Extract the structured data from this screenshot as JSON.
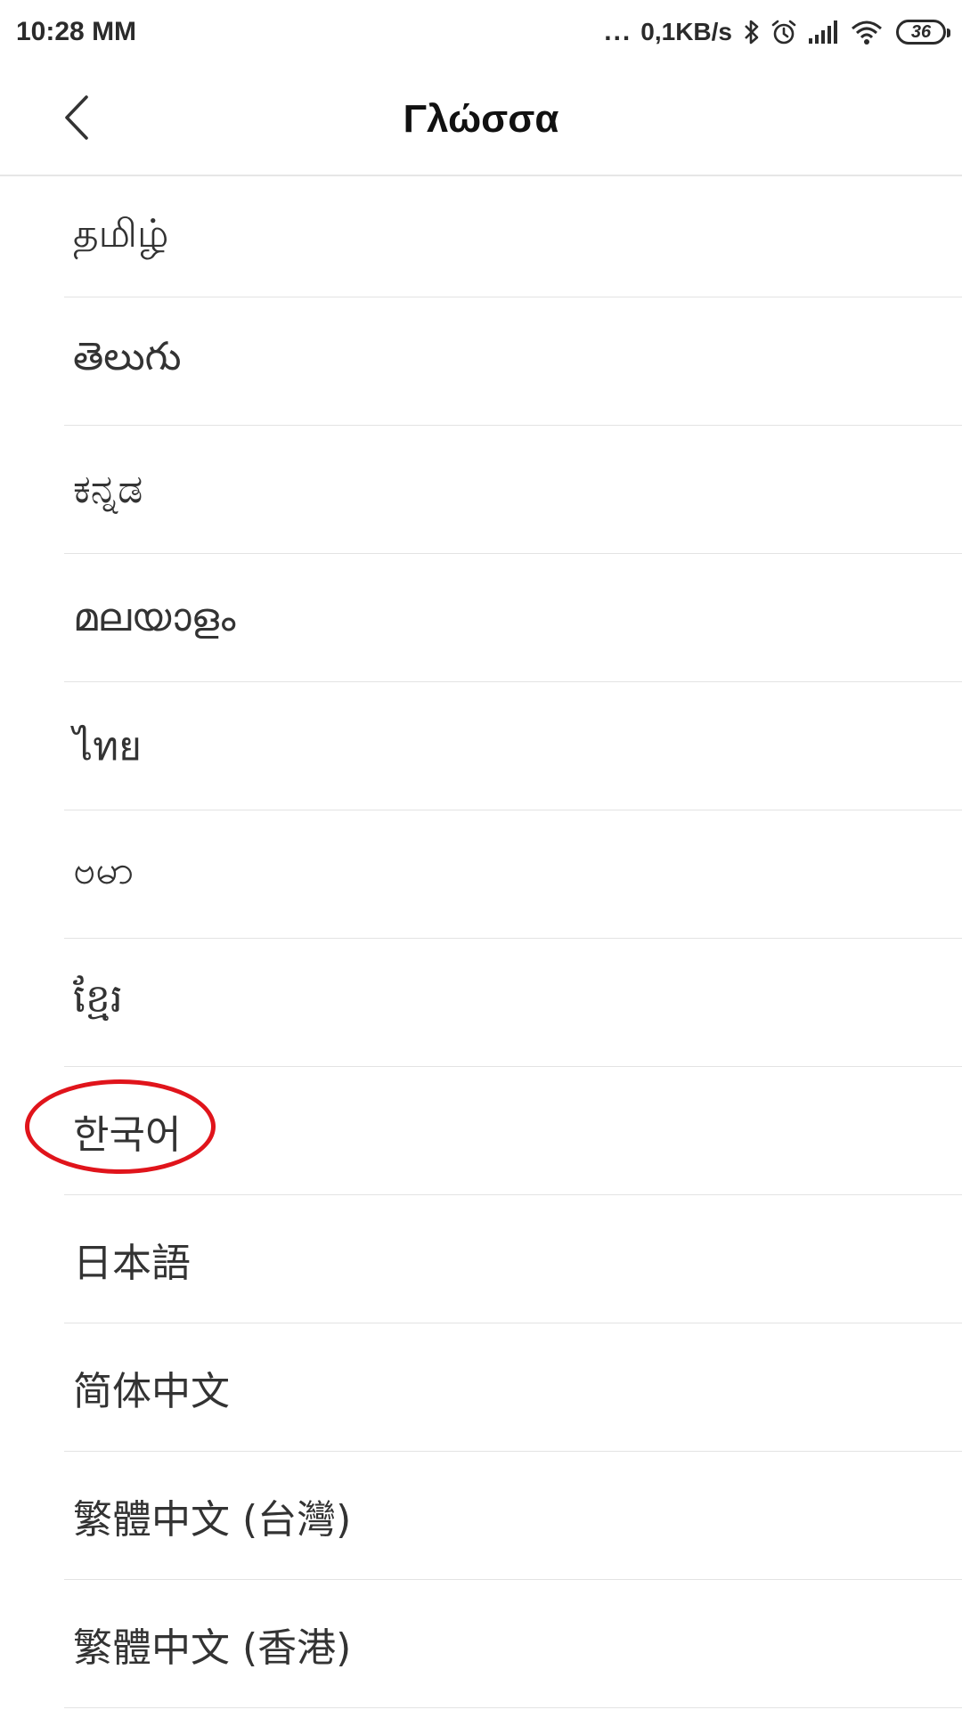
{
  "status_bar": {
    "time": "10:28 ΜΜ",
    "more_indicator": "...",
    "net_speed": "0,1KB/s",
    "battery_level": "36",
    "icons": [
      "bluetooth-icon",
      "alarm-icon",
      "signal-icon",
      "wifi-icon",
      "battery-icon"
    ]
  },
  "header": {
    "title": "Γλώσσα",
    "back_icon": "chevron-left-icon"
  },
  "languages": [
    {
      "label": "தமிழ்"
    },
    {
      "label": "తెలుగు"
    },
    {
      "label": "ಕನ್ನಡ"
    },
    {
      "label": "മലയാളം"
    },
    {
      "label": "ไทย"
    },
    {
      "label": "ဗမာ"
    },
    {
      "label": "ខ្មែរ"
    },
    {
      "label": "한국어",
      "highlighted": true
    },
    {
      "label": "日本語"
    },
    {
      "label": "简体中文"
    },
    {
      "label": "繁體中文 (台灣)"
    },
    {
      "label": "繁體中文 (香港)"
    }
  ],
  "colors": {
    "highlight_ring": "#e0141b",
    "text": "#333333",
    "divider": "#e3e3e3"
  }
}
